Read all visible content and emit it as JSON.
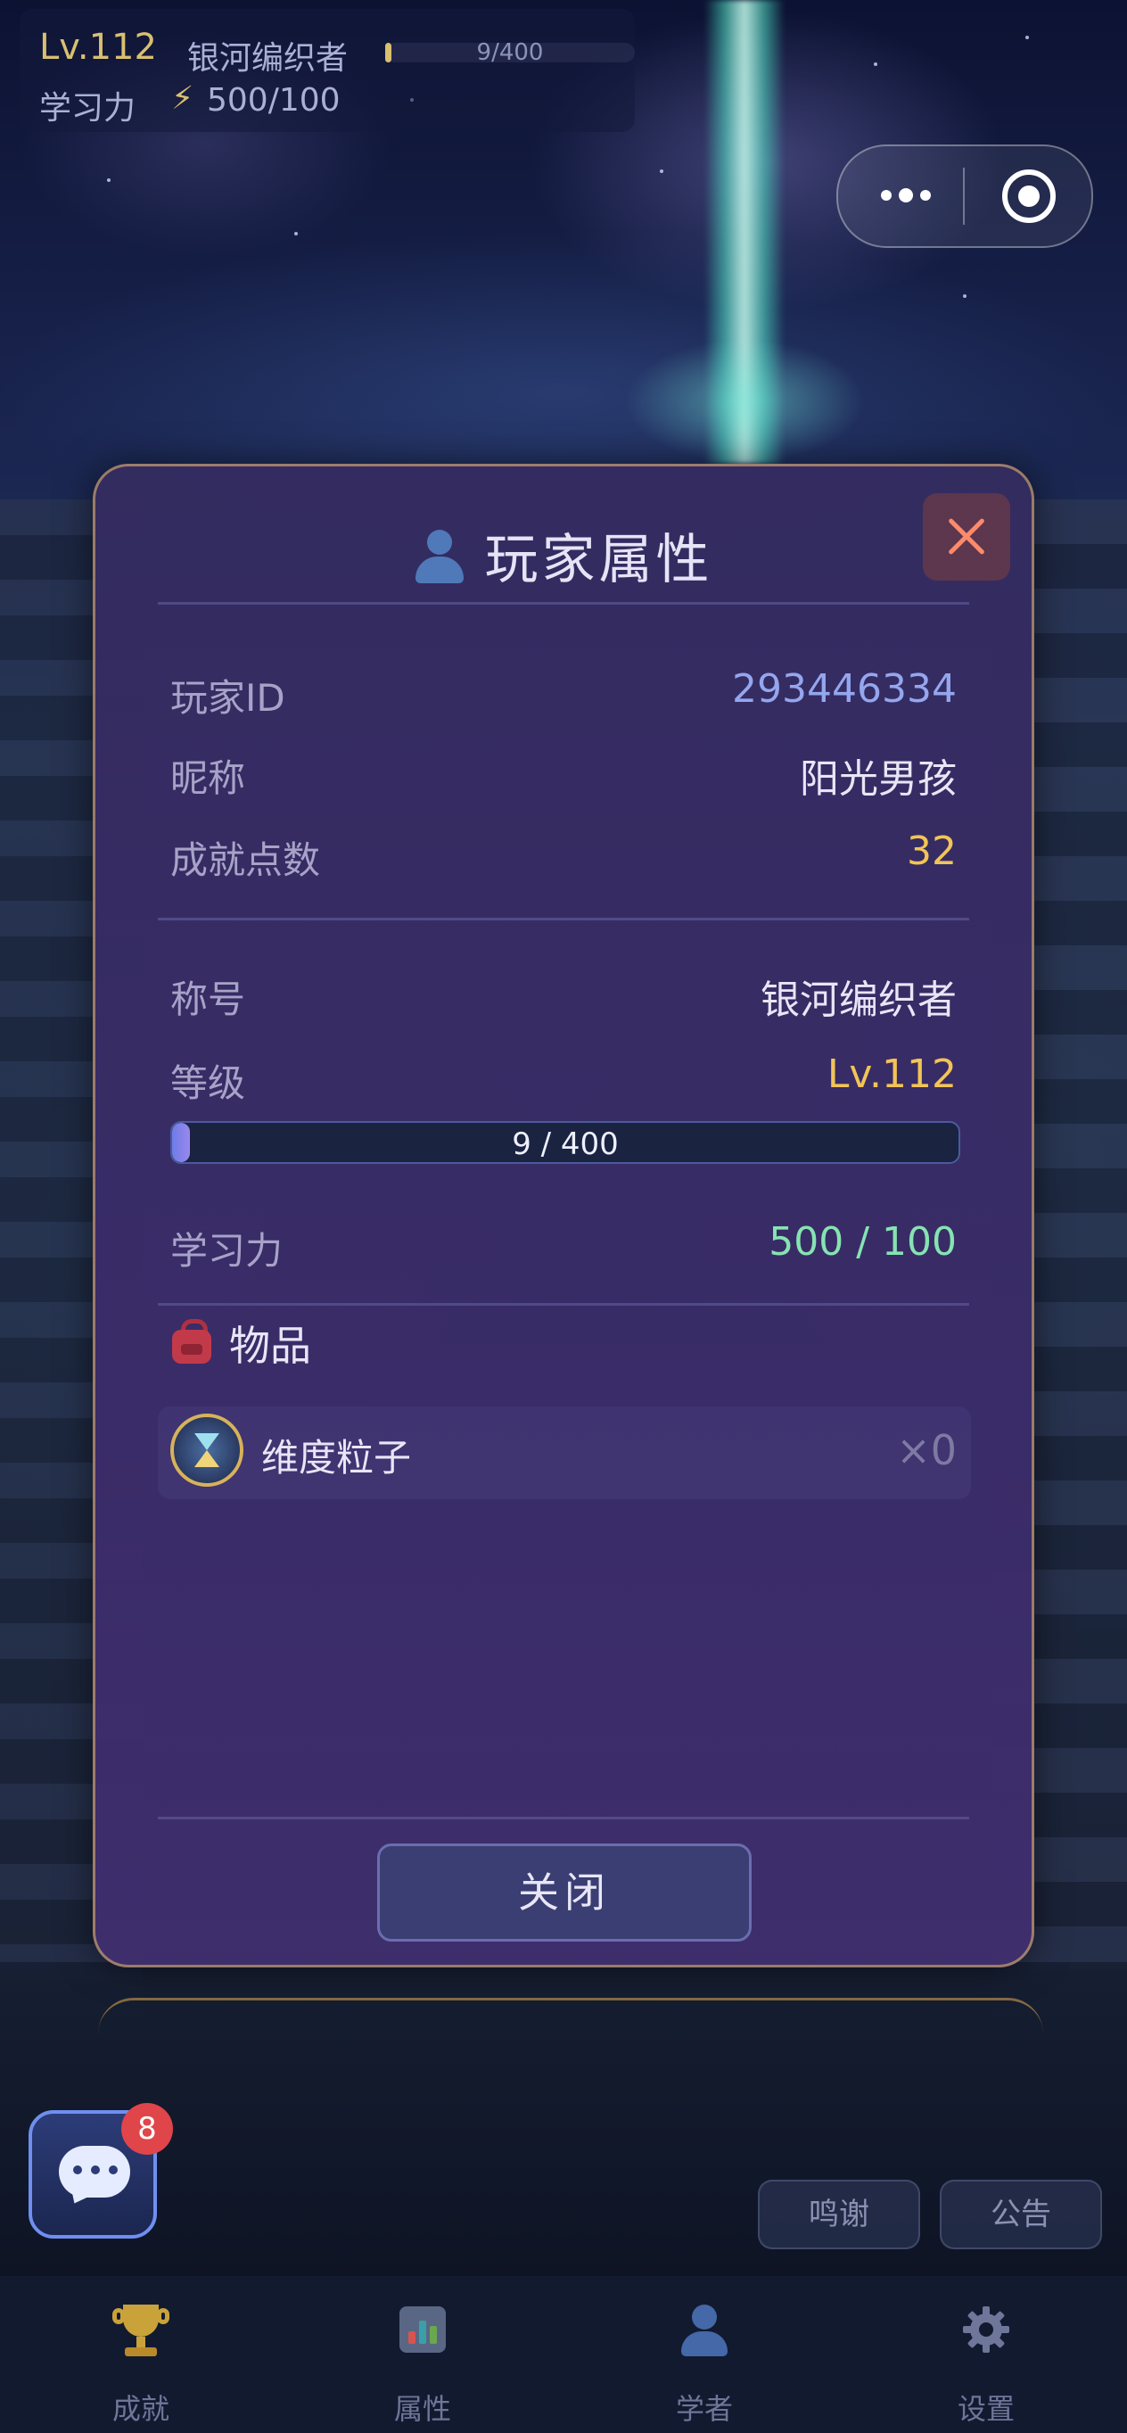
{
  "hud": {
    "level": "Lv.112",
    "title": "银河编织者",
    "exp_text": "9/400",
    "exp_progress": 0.0225,
    "power_label": "学习力",
    "power_value": "500/100"
  },
  "modal": {
    "title": "玩家属性",
    "rows": {
      "player_id": {
        "label": "玩家ID",
        "value": "293446334"
      },
      "nickname": {
        "label": "昵称",
        "value": "阳光男孩"
      },
      "achievement_points": {
        "label": "成就点数",
        "value": "32"
      },
      "title": {
        "label": "称号",
        "value": "银河编织者"
      },
      "level": {
        "label": "等级",
        "value": "Lv.112"
      },
      "learning_power": {
        "label": "学习力",
        "value": "500 / 100"
      }
    },
    "level_progress": {
      "text": "9 / 400",
      "fraction": 0.0225
    },
    "items_title": "物品",
    "items": [
      {
        "name": "维度粒子",
        "count": "×0",
        "icon": "hourglass-icon"
      }
    ],
    "close_label": "关闭"
  },
  "chat": {
    "badge": "8"
  },
  "side_buttons": {
    "thanks": "鸣谢",
    "notice": "公告"
  },
  "tabs": [
    {
      "label": "成就",
      "icon": "trophy-icon"
    },
    {
      "label": "属性",
      "icon": "bar-chart-icon"
    },
    {
      "label": "学者",
      "icon": "user-icon"
    },
    {
      "label": "设置",
      "icon": "gear-icon"
    }
  ],
  "colors": {
    "accent_gold": "#f2c457",
    "accent_blue": "#94a6ee",
    "accent_green": "#86e3b2",
    "close_red": "#ff8a6a",
    "badge_red": "#e0454a"
  }
}
